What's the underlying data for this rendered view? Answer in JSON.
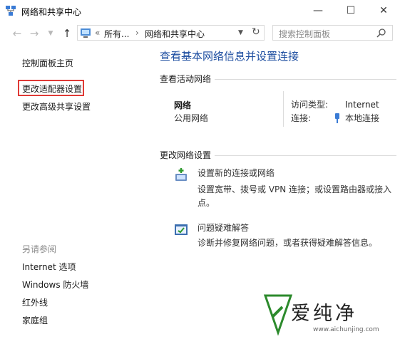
{
  "window": {
    "title": "网络和共享中心"
  },
  "nav": {
    "breadcrumb_prefix": "«",
    "crumb1": "所有...",
    "crumb_sep": "›",
    "crumb2": "网络和共享中心",
    "search_placeholder": "搜索控制面板"
  },
  "sidebar": {
    "home": "控制面板主页",
    "adapter": "更改适配器设置",
    "advanced": "更改高级共享设置",
    "see_also": "另请参阅",
    "items": [
      "Internet 选项",
      "Windows 防火墙",
      "红外线",
      "家庭组"
    ]
  },
  "main": {
    "title": "查看基本网络信息并设置连接",
    "active_networks": "查看活动网络",
    "network_name": "网络",
    "network_type": "公用网络",
    "access_type_label": "访问类型:",
    "access_type_value": "Internet",
    "connections_label": "连接:",
    "connection_link": "本地连接",
    "change_settings": "更改网络设置",
    "setup_link": "设置新的连接或网络",
    "setup_desc": "设置宽带、拨号或 VPN 连接；或设置路由器或接入点。",
    "troubleshoot_link": "问题疑难解答",
    "troubleshoot_desc": "诊断并修复网络问题，或者获得疑难解答信息。"
  },
  "watermark": {
    "brand": "爱纯净",
    "url": "www.aichunjing.com"
  },
  "colors": {
    "link": "#1665c1",
    "title": "#1c4da0",
    "highlight": "#e03a36",
    "watermark": "#2c8a2c"
  }
}
